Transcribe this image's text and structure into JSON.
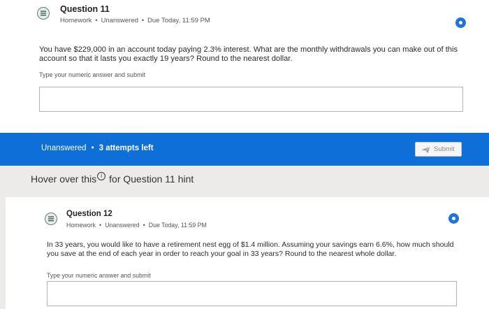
{
  "question11": {
    "title": "Question 11",
    "meta": [
      "Homework",
      "Unanswered",
      "Due Today, 11:59 PM"
    ],
    "text": "You have $229,000 in an account today paying 2.3% interest. What are the monthly withdrawals you can make out of this account so that it lasts you exactly 19 years? Round to the nearest dollar.",
    "answer_label": "Type your numeric answer and submit",
    "answer_value": ""
  },
  "status": {
    "state": "Unanswered",
    "attempts": "3 attempts left",
    "submit_label": "Submit"
  },
  "hint": {
    "before": "Hover over this",
    "icon_glyph": "i",
    "after": "for Question 11 hint"
  },
  "question12": {
    "title": "Question 12",
    "meta": [
      "Homework",
      "Unanswered",
      "Due Today, 11:59 PM"
    ],
    "text": "In 33 years, you would like to have a retirement nest egg of $1.4 million. Assuming your savings earn 6.6%, how much should you save at the end of each year in order to reach your goal in 33 years? Round to the nearest whole dollar.",
    "answer_label": "Type your numeric answer and submit",
    "answer_value": ""
  },
  "colors": {
    "status_bar": "#0f6fd8",
    "info_button": "#1f74d6",
    "page_background": "#ecebea"
  },
  "icons": {
    "question_icon": "list-icon",
    "info_button": "info-dot-icon",
    "submit_icon": "send-icon",
    "hint_icon": "info-circle-icon"
  }
}
